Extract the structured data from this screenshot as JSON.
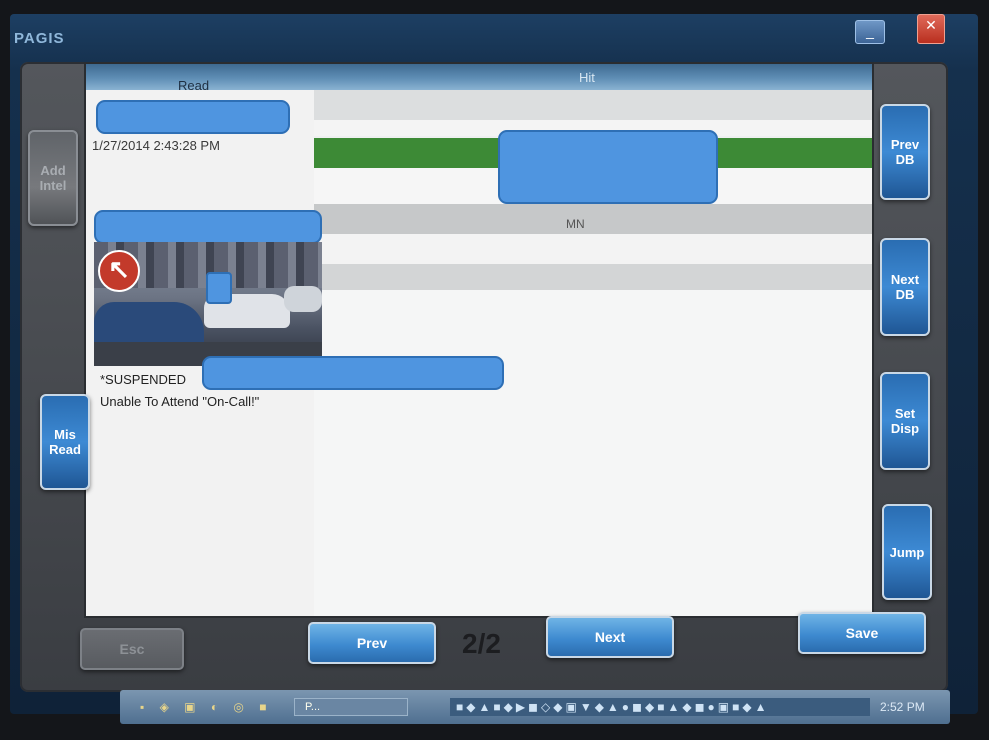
{
  "window": {
    "title": "PAGIS",
    "minimize_label": "_",
    "close_label": "✕"
  },
  "header": {
    "read_label": "Read",
    "hit_label": "Hit"
  },
  "read": {
    "timestamp": "1/27/2014 2:43:28 PM",
    "status_prefix": "*SUSPENDED",
    "note": "Unable To Attend \"On-Call!\""
  },
  "hit": {
    "state_label": "MN"
  },
  "side_buttons_left": [
    {
      "label_line1": "Add",
      "label_line2": "Intel",
      "enabled": false
    },
    {
      "label_line1": "Mis",
      "label_line2": "Read",
      "enabled": true
    }
  ],
  "side_buttons_right": [
    {
      "label_line1": "Prev",
      "label_line2": "DB"
    },
    {
      "label_line1": "Next",
      "label_line2": "DB"
    },
    {
      "label_line1": "Set",
      "label_line2": "Disp"
    },
    {
      "label_line1": "Jump",
      "label_line2": ""
    }
  ],
  "bottom": {
    "esc_label": "Esc",
    "prev_label": "Prev",
    "page_indicator": "2/2",
    "next_label": "Next",
    "save_label": "Save"
  },
  "taskbar": {
    "quicklaunch": "▪ ◈ ▣ ◐ ◎ ■",
    "task_label": "P...",
    "tray": "■◆▲■◆▶◼◇◆▣▼◆▲●◼◆■▲◆◼●▣■◆▲",
    "clock": "2:52 PM"
  }
}
